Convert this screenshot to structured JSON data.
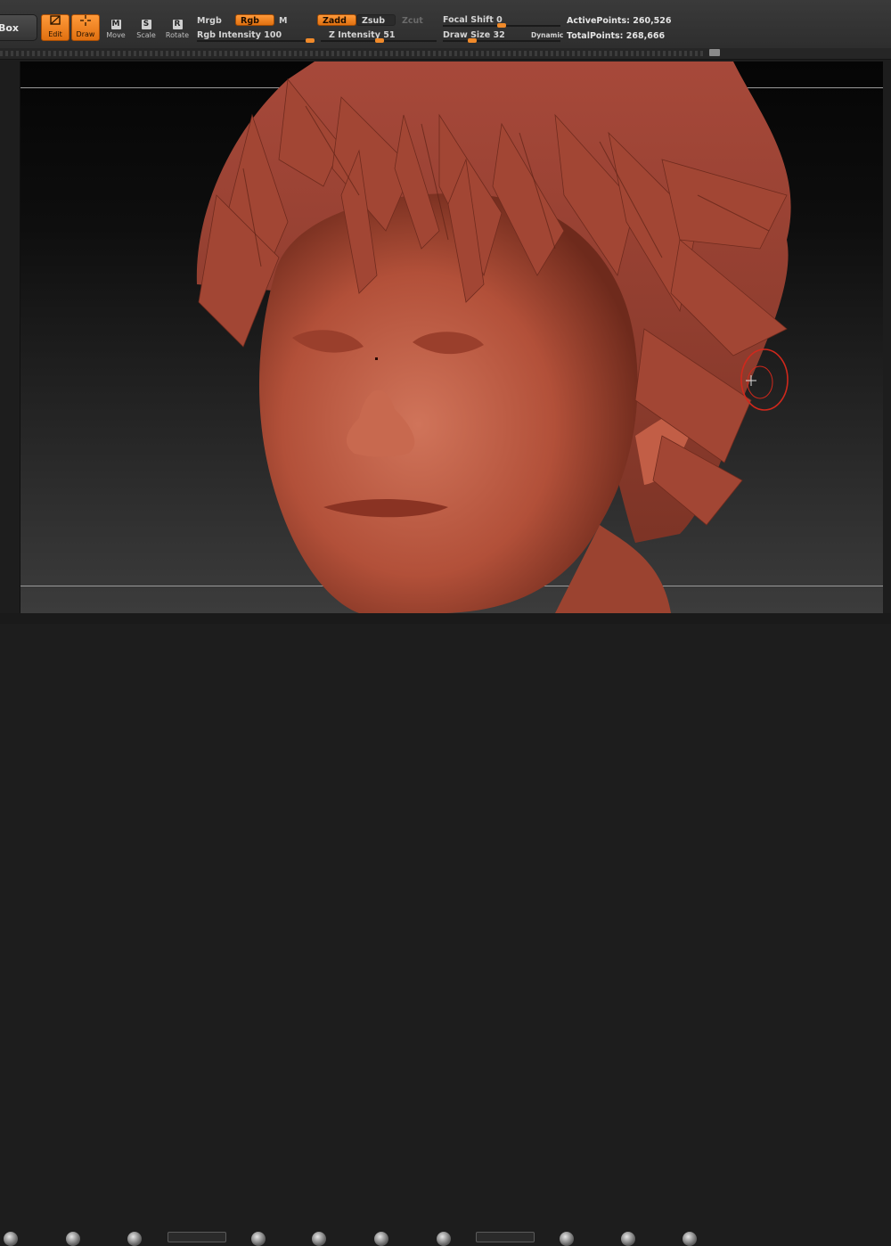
{
  "toolbar": {
    "lightbox_label": "tBox",
    "edit_label": "Edit",
    "draw_label": "Draw",
    "move_label": "Move",
    "scale_label": "Scale",
    "rotate_label": "Rotate",
    "move_letter": "M",
    "scale_letter": "S",
    "rotate_letter": "R"
  },
  "color_mode": {
    "mrgb": "Mrgb",
    "rgb": "Rgb",
    "m": "M",
    "rgb_intensity_label": "Rgb Intensity",
    "rgb_intensity_value": "100",
    "rgb_intensity": 1.0
  },
  "depth_mode": {
    "zadd": "Zadd",
    "zsub": "Zsub",
    "zcut": "Zcut",
    "z_intensity_label": "Z Intensity",
    "z_intensity_value": "51",
    "z_intensity": 0.51
  },
  "brush": {
    "focal_shift_label": "Focal Shift",
    "focal_shift_value": "0",
    "focal_shift": 0.5,
    "draw_size_label": "Draw Size",
    "draw_size_value": "32",
    "draw_size": 0.25,
    "dynamic_label": "Dynamic"
  },
  "stats": {
    "active_points_label": "ActivePoints:",
    "active_points_value": "260,526",
    "total_points_label": "TotalPoints:",
    "total_points_value": "268,666"
  },
  "colors": {
    "accent": "#f08a2a",
    "clay": "#b8523c",
    "brush_cursor": "#d0281c"
  }
}
